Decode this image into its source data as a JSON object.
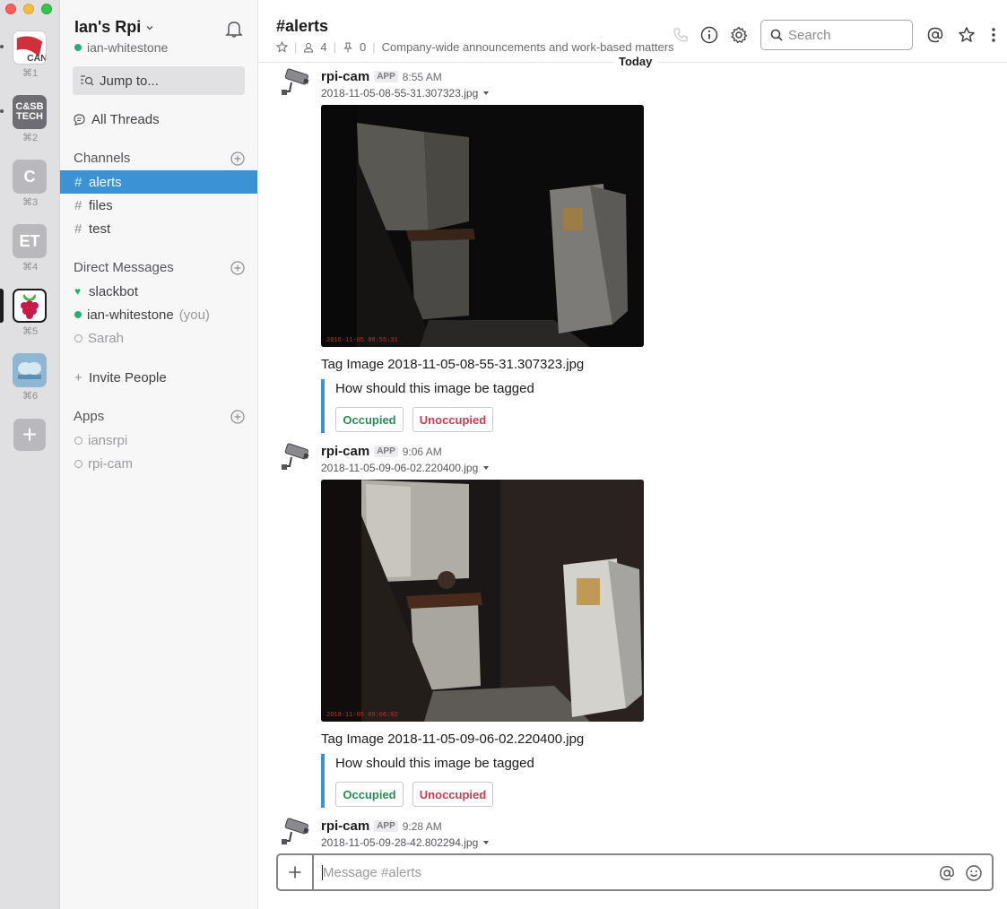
{
  "rail": {
    "workspaces": [
      {
        "initials": "CAN",
        "shortcut": "⌘1"
      },
      {
        "initials": "C&SB TECH",
        "shortcut": "⌘2"
      },
      {
        "initials": "C",
        "shortcut": "⌘3"
      },
      {
        "initials": "ET",
        "shortcut": "⌘4"
      },
      {
        "initials": "",
        "shortcut": "⌘5"
      },
      {
        "initials": "",
        "shortcut": "⌘6"
      }
    ],
    "add_label": "+"
  },
  "sidebar": {
    "team_name": "Ian's Rpi",
    "user_name": "ian-whitestone",
    "jump_placeholder": "Jump to...",
    "all_threads": "All Threads",
    "channels_heading": "Channels",
    "channels": [
      {
        "name": "alerts",
        "active": true
      },
      {
        "name": "files",
        "active": false
      },
      {
        "name": "test",
        "active": false
      }
    ],
    "dm_heading": "Direct Messages",
    "dms": [
      {
        "name": "slackbot",
        "suffix": ""
      },
      {
        "name": "ian-whitestone",
        "suffix": "(you)"
      },
      {
        "name": "Sarah",
        "suffix": ""
      }
    ],
    "invite": "Invite People",
    "apps_heading": "Apps",
    "apps": [
      {
        "name": "iansrpi"
      },
      {
        "name": "rpi-cam"
      }
    ]
  },
  "header": {
    "channel_title": "#alerts",
    "members_count": "4",
    "pins_count": "0",
    "topic": "Company-wide announcements and work-based matters",
    "search_placeholder": "Search"
  },
  "day_divider": "Today",
  "messages": [
    {
      "sender": "rpi-cam",
      "badge": "APP",
      "time": "8:55 AM",
      "filename": "2018-11-05-08-55-31.307323.jpg",
      "photo_stamp": "2018-11-05 08:55:31",
      "tag_text": "Tag Image 2018-11-05-08-55-31.307323.jpg",
      "question": "How should this image be tagged",
      "btn_yes": "Occupied",
      "btn_no": "Unoccupied"
    },
    {
      "sender": "rpi-cam",
      "badge": "APP",
      "time": "9:06 AM",
      "filename": "2018-11-05-09-06-02.220400.jpg",
      "photo_stamp": "2018-11-05 09:06:02",
      "tag_text": "Tag Image 2018-11-05-09-06-02.220400.jpg",
      "question": "How should this image be tagged",
      "btn_yes": "Occupied",
      "btn_no": "Unoccupied"
    },
    {
      "sender": "rpi-cam",
      "badge": "APP",
      "time": "9:28 AM",
      "filename": "2018-11-05-09-28-42.802294.jpg"
    }
  ],
  "composer": {
    "placeholder": "Message #alerts"
  },
  "colors": {
    "active_channel": "#3b93d6",
    "online": "#2bac76",
    "occupied": "#2a8b5a",
    "unoccupied": "#d0394f"
  }
}
